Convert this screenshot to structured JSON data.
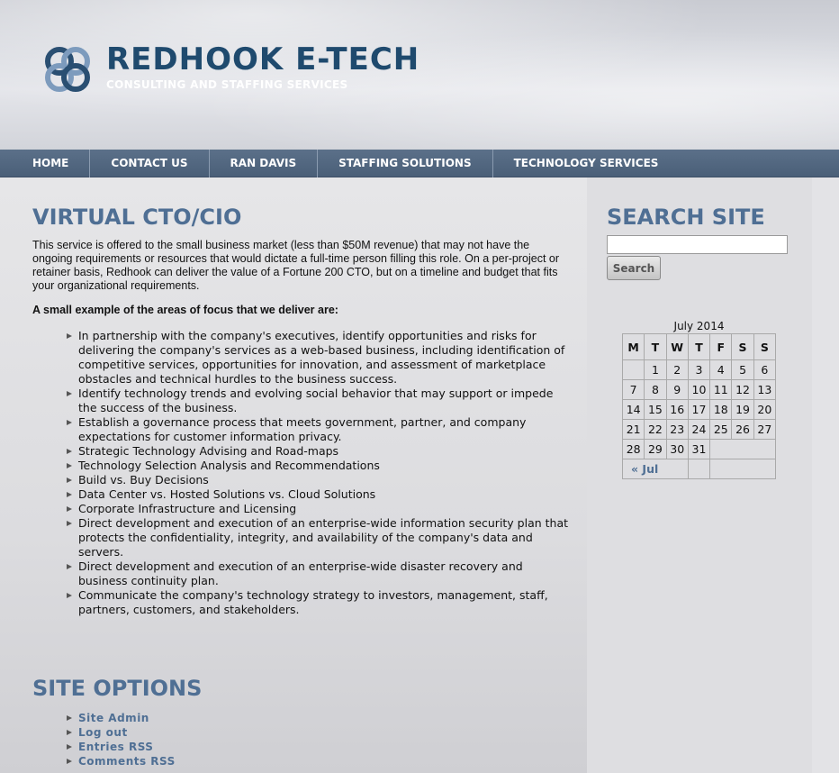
{
  "header": {
    "title": "REDHOOK E-TECH",
    "tagline": "CONSULTING AND STAFFING SERVICES",
    "logo_icon": "interlocking-rings-logo"
  },
  "nav": {
    "items": [
      {
        "label": "HOME"
      },
      {
        "label": "CONTACT US"
      },
      {
        "label": "RAN DAVIS"
      },
      {
        "label": "STAFFING SOLUTIONS"
      },
      {
        "label": "TECHNOLOGY SERVICES"
      }
    ]
  },
  "main": {
    "heading": "VIRTUAL CTO/CIO",
    "intro": "This service is offered to the small business market (less than $50M revenue) that may not have the ongoing requirements or resources that would dictate a full-time person filling this role. On a per-project or retainer basis, Redhook can deliver the value of a Fortune 200 CTO, but on a timeline and budget that fits your organizational requirements.",
    "areas_heading": "A small example of the areas of focus that we deliver are:",
    "focus_items": [
      "In partnership with the company's executives, identify opportunities and risks for delivering the company's services as a web-based business, including identification of competitive services, opportunities for innovation, and assessment of marketplace obstacles and technical hurdles to the business success.",
      "Identify technology trends and evolving social behavior that may support or impede the success of the business.",
      "Establish a governance process that meets government, partner, and company expectations for customer information privacy.",
      "Strategic Technology Advising and Road-maps",
      "Technology Selection Analysis and Recommendations",
      "Build vs. Buy Decisions",
      "Data Center vs. Hosted Solutions vs. Cloud Solutions",
      "Corporate Infrastructure and Licensing",
      "Direct development and execution of an enterprise-wide information security plan that protects the confidentiality, integrity, and availability of the company's data and servers.",
      "Direct development and execution of an enterprise-wide disaster recovery and business continuity plan.",
      "Communicate the company's technology strategy to investors, management, staff, partners, customers, and stakeholders."
    ],
    "options_heading": "SITE OPTIONS",
    "options": [
      {
        "label": "Site Admin"
      },
      {
        "label": "Log out"
      },
      {
        "label": "Entries RSS"
      },
      {
        "label": "Comments RSS"
      }
    ]
  },
  "sidebar": {
    "search_heading": "SEARCH SITE",
    "search_value": "",
    "search_button": "Search",
    "calendar": {
      "caption": "July 2014",
      "weekdays": [
        "M",
        "T",
        "W",
        "T",
        "F",
        "S",
        "S"
      ],
      "weeks": [
        [
          "",
          "1",
          "2",
          "3",
          "4",
          "5",
          "6"
        ],
        [
          "7",
          "8",
          "9",
          "10",
          "11",
          "12",
          "13"
        ],
        [
          "14",
          "15",
          "16",
          "17",
          "18",
          "19",
          "20"
        ],
        [
          "21",
          "22",
          "23",
          "24",
          "25",
          "26",
          "27"
        ],
        [
          "28",
          "29",
          "30",
          "31",
          "",
          "",
          ""
        ]
      ],
      "prev_link": "« Jul"
    }
  },
  "colors": {
    "title_blue": "#1f4a6e",
    "heading_blue": "#4f6f94",
    "nav_bg": "#4e637c"
  }
}
